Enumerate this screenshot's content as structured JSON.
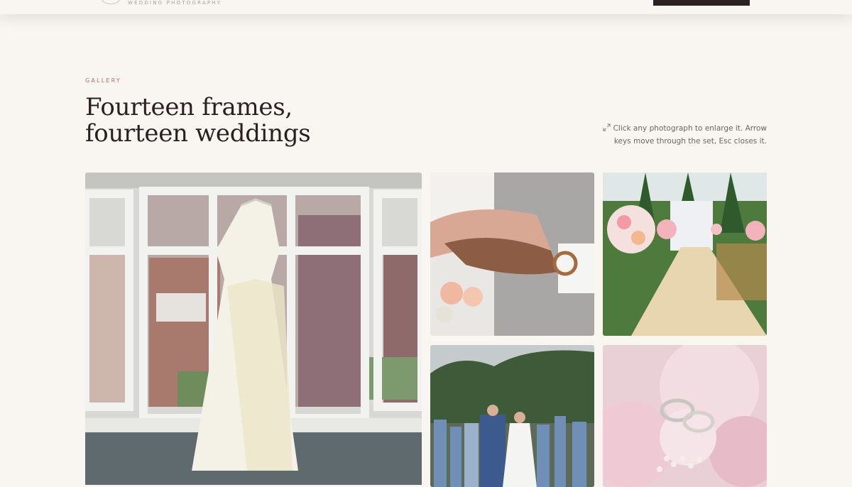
{
  "header": {
    "tagline": "WEDDING PHOTOGRAPHY"
  },
  "gallery": {
    "eyebrow": "GALLERY",
    "title_line1": "Fourteen frames,",
    "title_line2": "fourteen weddings",
    "hint": "Click any photograph to enlarge it. Arrow keys move through the set, Esc closes it.",
    "hint_icon": "expand-icon",
    "photos": [
      {
        "subject": "wedding-dress-in-window"
      },
      {
        "subject": "hands-with-rings"
      },
      {
        "subject": "ceremony-aisle"
      },
      {
        "subject": "guests-celebrating"
      },
      {
        "subject": "rings-on-roses"
      }
    ]
  },
  "colors": {
    "background": "#f9f6f2",
    "ink": "#2a1f22",
    "accent": "#b06e6a",
    "cta": "#2b2024"
  }
}
